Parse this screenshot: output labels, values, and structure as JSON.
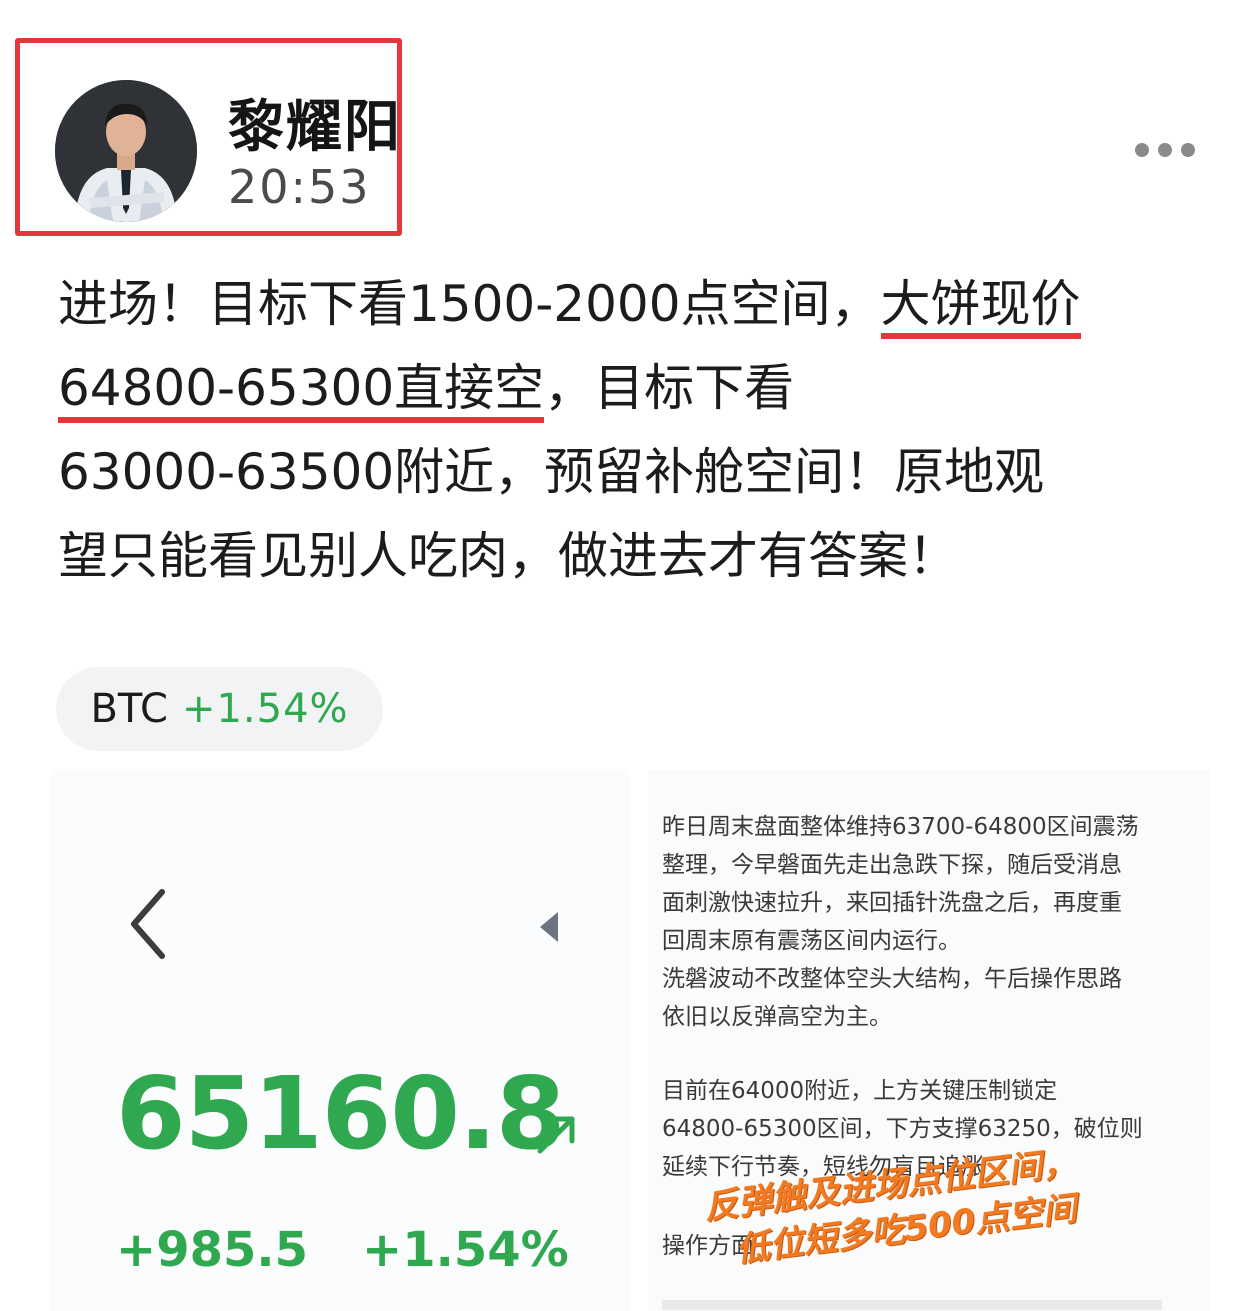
{
  "author": {
    "name": "黎耀阳",
    "time": "20:53"
  },
  "post": {
    "segments": [
      "进场！目标下看1500-2000点空间，",
      "大饼现价",
      "64800-65300直接空",
      "，目标下看",
      "63000-63500附近，预留补舱空间！原地观",
      "望只能看见别人吃肉，做进去才有答案！"
    ]
  },
  "ticker": {
    "symbol": "BTC",
    "change": "+1.54%"
  },
  "embed": {
    "price": "65160.8",
    "change_abs": "+985.5",
    "change_pct": "+1.54%",
    "analysis_lines": [
      "昨日周末盘面整体维持63700-64800区间震荡",
      "整理，今早磐面先走出急跌下探，随后受消息",
      "面刺激快速拉升，来回插针洗盘之后，再度重",
      "回周末原有震荡区间内运行。",
      "洗磐波动不改整体空头大结构，午后操作思路",
      "依旧以反弹高空为主。"
    ],
    "analysis_lines_2": [
      "目前在64000附近，上方关键压制锁定",
      "64800-65300区间，下方支撑63250，破位则",
      "延续下行节奏，短线勿盲目追涨"
    ],
    "op_label": "操作方面",
    "stamp_line1": "反弹触及进场点位区间，",
    "stamp_line2": "低位短多吃500点空间"
  },
  "colors": {
    "accent_red": "#e5363c",
    "up_green": "#2fa84f",
    "stamp_orange": "#f27a20"
  },
  "icons": [
    "more-dots-icon",
    "chevron-left-icon",
    "caret-left-icon",
    "arrow-up-right-icon"
  ]
}
